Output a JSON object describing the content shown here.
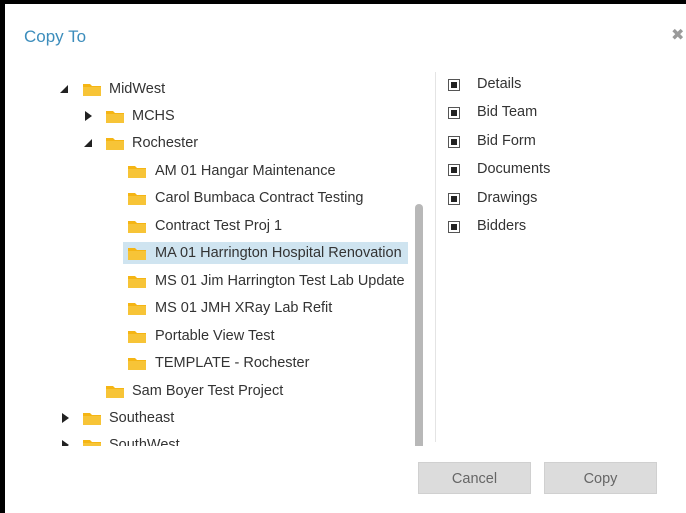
{
  "dialog": {
    "title": "Copy To",
    "close_glyph": "✖"
  },
  "tree": {
    "items": [
      {
        "label": "MidWest",
        "state": "expanded"
      },
      {
        "label": "MCHS",
        "state": "collapsed"
      },
      {
        "label": "Rochester",
        "state": "expanded"
      },
      {
        "label": "AM 01 Hangar Maintenance",
        "state": "leaf"
      },
      {
        "label": "Carol Bumbaca Contract Testing",
        "state": "leaf"
      },
      {
        "label": "Contract Test Proj 1",
        "state": "leaf"
      },
      {
        "label": "MA 01 Harrington Hospital Renovation",
        "state": "leaf",
        "selected": true
      },
      {
        "label": "MS 01 Jim Harrington Test Lab Update",
        "state": "leaf"
      },
      {
        "label": "MS 01 JMH XRay Lab Refit",
        "state": "leaf"
      },
      {
        "label": "Portable View Test",
        "state": "leaf"
      },
      {
        "label": "TEMPLATE - Rochester",
        "state": "leaf"
      },
      {
        "label": "Sam Boyer Test Project",
        "state": "leaf"
      },
      {
        "label": "Southeast",
        "state": "collapsed"
      },
      {
        "label": "SouthWest",
        "state": "collapsed"
      }
    ]
  },
  "options": {
    "items": [
      {
        "label": "Details",
        "checked": true
      },
      {
        "label": "Bid Team",
        "checked": true
      },
      {
        "label": "Bid Form",
        "checked": true
      },
      {
        "label": "Documents",
        "checked": true
      },
      {
        "label": "Drawings",
        "checked": true
      },
      {
        "label": "Bidders",
        "checked": true
      }
    ]
  },
  "buttons": {
    "cancel": "Cancel",
    "copy": "Copy"
  },
  "colors": {
    "title": "#3c8dbc",
    "folder": "#f5b514",
    "selected_row": "#cfe4f0",
    "button_bg": "#dcdcdc"
  },
  "icons": {
    "folder": "folder-icon",
    "expand": "caret-right-icon",
    "collapse": "caret-down-icon",
    "close": "close-icon",
    "checkbox": "checkbox-icon"
  }
}
